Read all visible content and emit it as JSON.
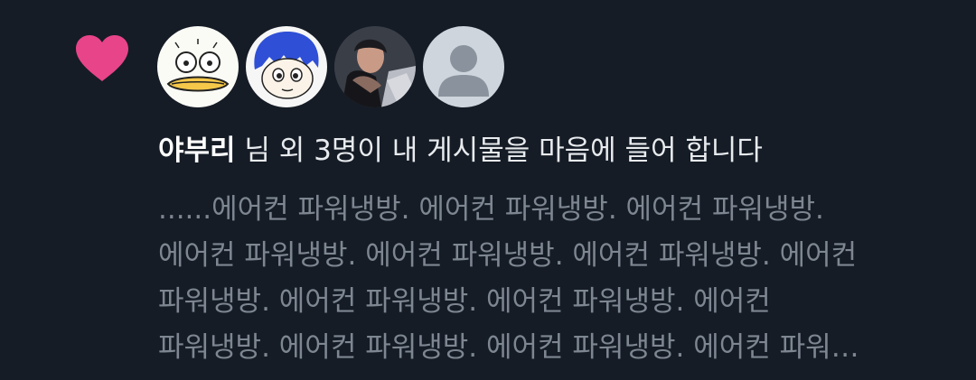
{
  "notification": {
    "type": "like",
    "icon": "heart-icon",
    "accent_color": "#e8448a",
    "avatars": [
      {
        "name": "duck-avatar",
        "icon": "duck-face"
      },
      {
        "name": "blue-hair-avatar",
        "icon": "cartoon-boy-blue-hair"
      },
      {
        "name": "photo-avatar",
        "icon": "photo"
      },
      {
        "name": "default-avatar",
        "icon": "default-user-silhouette"
      }
    ],
    "username": "야부리",
    "message": " 님 외 3명이 내 게시물을 마음에 들어 합니다",
    "preview_lines": [
      "......에어컨 파워냉방. 에어컨 파워냉방. 에어컨 파워냉방.",
      "에어컨 파워냉방. 에어컨 파워냉방. 에어컨 파워냉방. 에어컨",
      "파워냉방. 에어컨 파워냉방. 에어컨 파워냉방. 에어컨",
      "파워냉방. 에어컨 파워냉방. 에어컨 파워냉방. 에어컨 파워…"
    ]
  }
}
